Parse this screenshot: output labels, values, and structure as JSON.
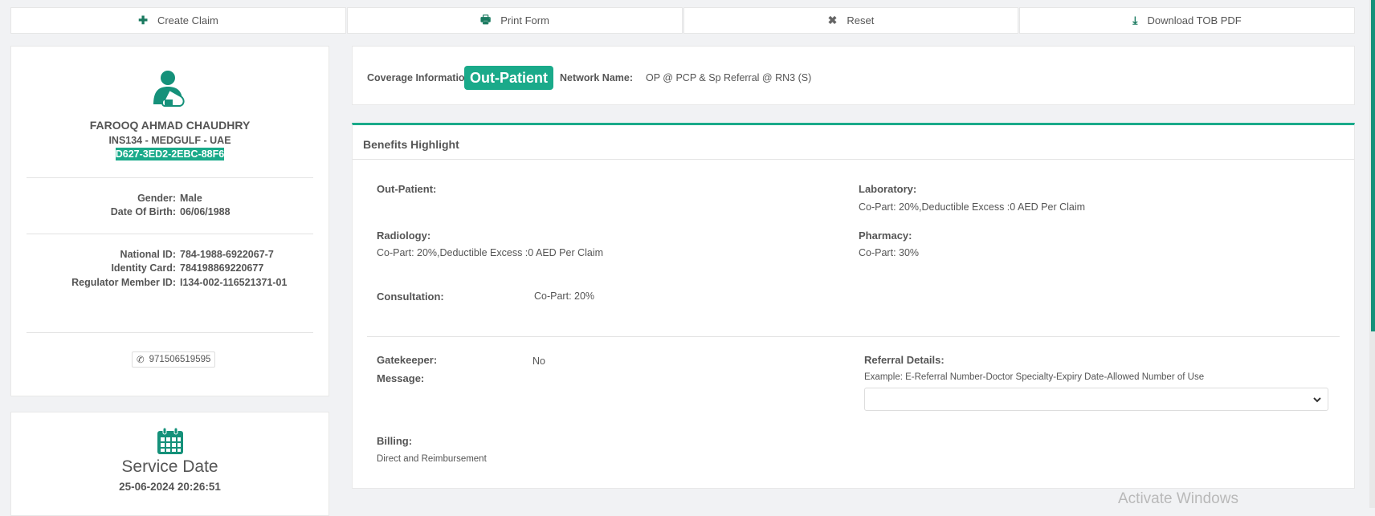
{
  "toolbar": {
    "create_claim": "Create Claim",
    "print_form": "Print Form",
    "reset": "Reset",
    "download_tob": "Download TOB PDF"
  },
  "member": {
    "name": "FAROOQ AHMAD CHAUDHRY",
    "insurer": "INS134 - MEDGULF - UAE",
    "card_id": "D627-3ED2-2EBC-88F6",
    "gender_label": "Gender:",
    "gender": "Male",
    "dob_label": "Date Of Birth:",
    "dob": "06/06/1988",
    "national_id_label": "National ID:",
    "national_id": "784-1988-6922067-7",
    "identity_card_label": "Identity Card:",
    "identity_card": "784198869220677",
    "regulator_label": "Regulator Member ID:",
    "regulator_id": "I134-002-116521371-01",
    "phone": "971506519595"
  },
  "service": {
    "title": "Service Date",
    "date": "25-06-2024 20:26:51"
  },
  "coverage": {
    "label": "Coverage Information:",
    "type": "Out-Patient",
    "network_label": "Network Name:",
    "network": "OP @ PCP & Sp Referral @ RN3 (S)"
  },
  "benefits": {
    "title": "Benefits Highlight",
    "out_patient_label": "Out-Patient:",
    "laboratory_label": "Laboratory:",
    "laboratory": "Co-Part: 20%,Deductible Excess :0 AED Per Claim",
    "radiology_label": "Radiology:",
    "radiology": "Co-Part: 20%,Deductible Excess :0 AED Per Claim",
    "pharmacy_label": "Pharmacy:",
    "pharmacy": "Co-Part: 30%",
    "consultation_label": "Consultation:",
    "consultation": "Co-Part: 20%",
    "gatekeeper_label": "Gatekeeper:",
    "gatekeeper": "No",
    "message_label": "Message:",
    "referral_label": "Referral Details:",
    "referral_example": "Example: E-Referral Number-Doctor Specialty-Expiry Date-Allowed Number of Use",
    "billing_label": "Billing:",
    "billing": "Direct and Reimbursement"
  },
  "watermark": "Activate Windows",
  "colors": {
    "accent": "#1aaa8a",
    "icon": "#15917a"
  }
}
